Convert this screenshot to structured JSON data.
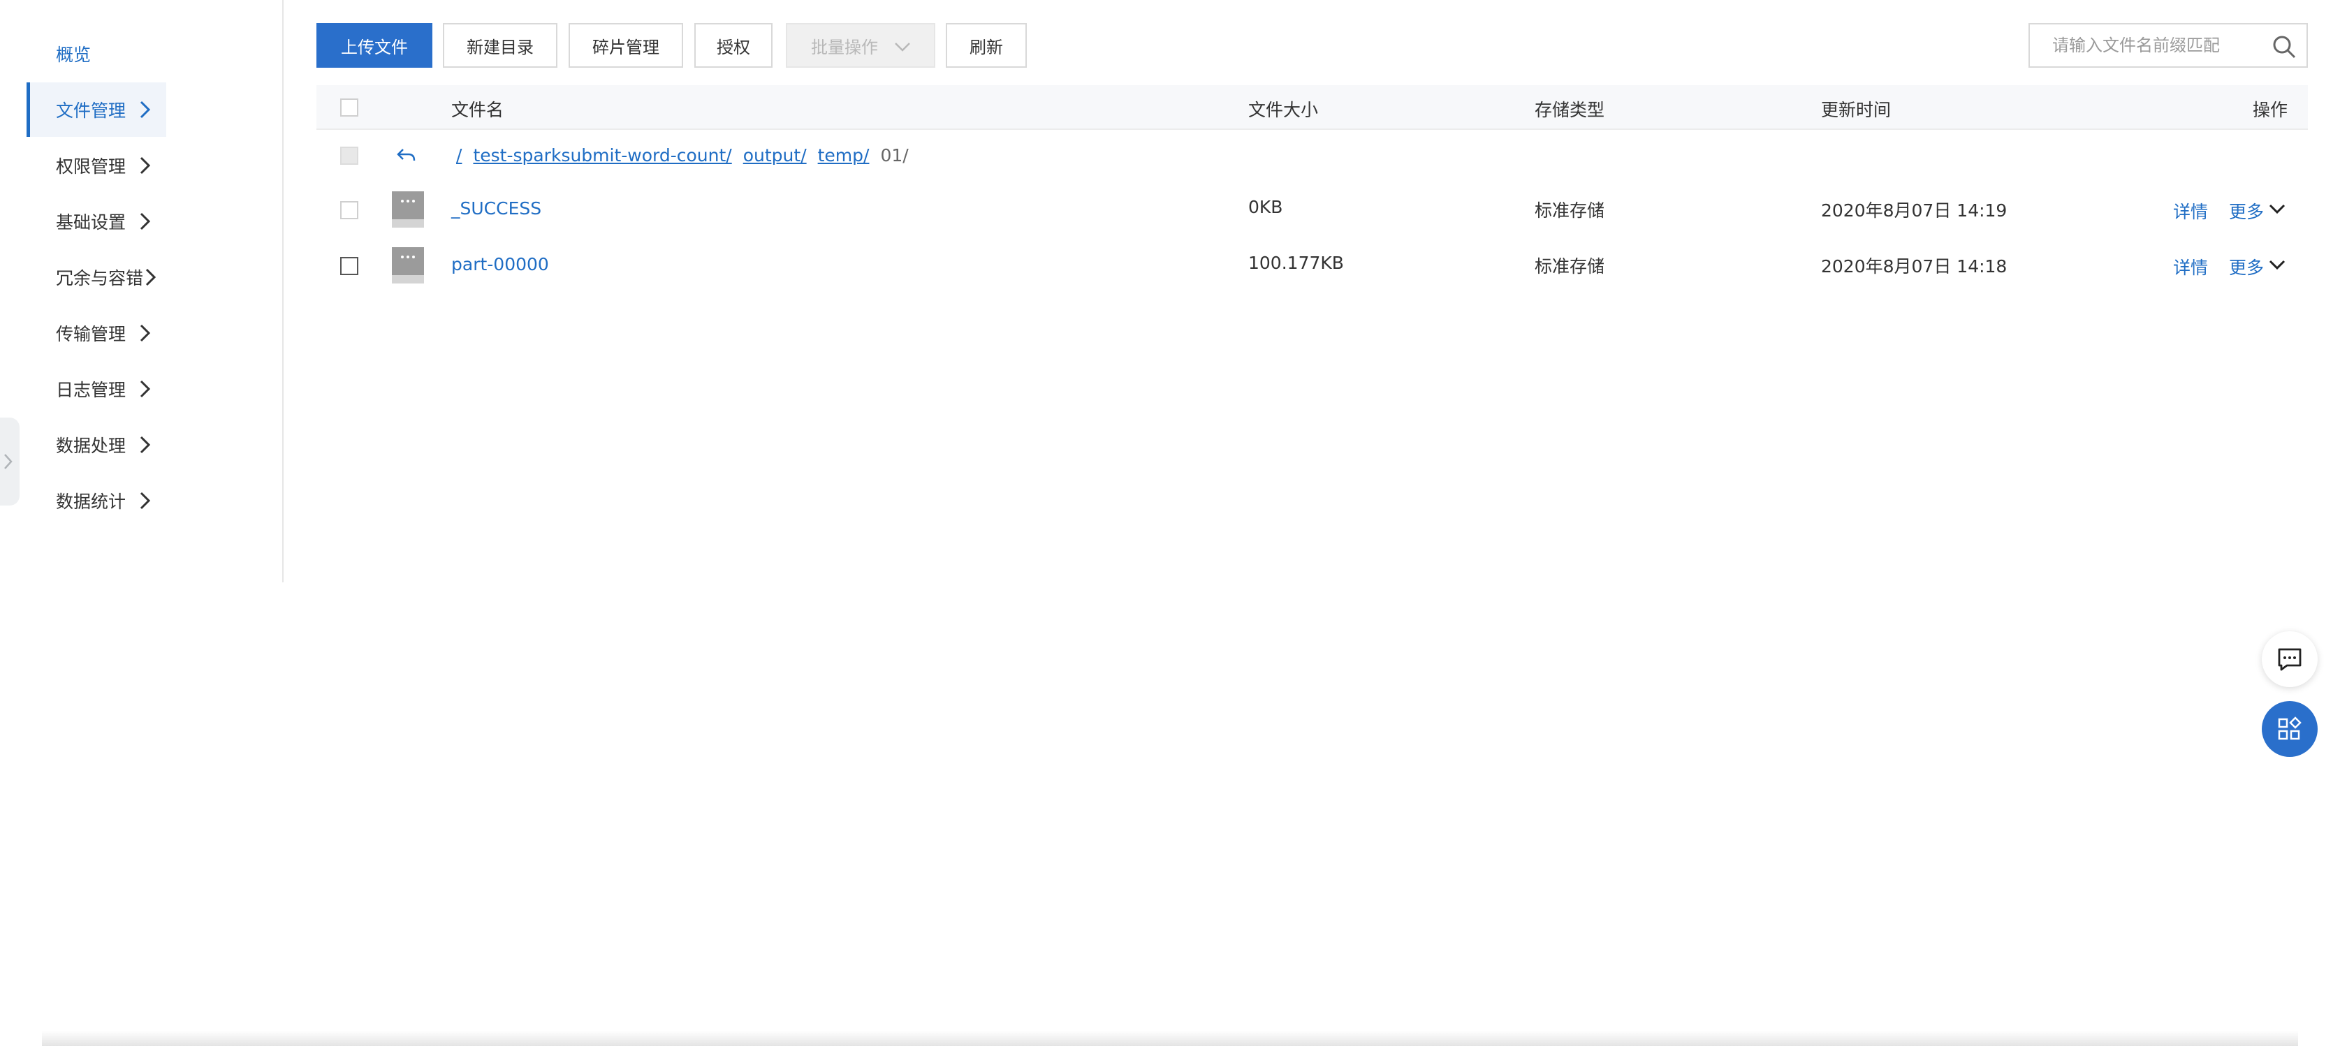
{
  "sidebar": {
    "overview": "概览",
    "items": [
      {
        "label": "文件管理",
        "active": true
      },
      {
        "label": "权限管理"
      },
      {
        "label": "基础设置"
      },
      {
        "label": "冗余与容错"
      },
      {
        "label": "传输管理"
      },
      {
        "label": "日志管理"
      },
      {
        "label": "数据处理"
      },
      {
        "label": "数据统计"
      }
    ]
  },
  "toolbar": {
    "upload": "上传文件",
    "new_dir": "新建目录",
    "fragments": "碎片管理",
    "authorize": "授权",
    "batch": "批量操作",
    "refresh": "刷新"
  },
  "search": {
    "placeholder": "请输入文件名前缀匹配",
    "value": ""
  },
  "table": {
    "headers": {
      "name": "文件名",
      "size": "文件大小",
      "storage": "存储类型",
      "updated": "更新时间",
      "actions": "操作"
    },
    "breadcrumb": [
      "/",
      "test-sparksubmit-word-count/",
      "output/",
      "temp/",
      "01/"
    ],
    "rows": [
      {
        "name": "_SUCCESS",
        "size": "0KB",
        "storage": "标准存储",
        "updated": "2020年8月07日 14:19",
        "detail": "详情",
        "more": "更多"
      },
      {
        "name": "part-00000",
        "size": "100.177KB",
        "storage": "标准存储",
        "updated": "2020年8月07日 14:18",
        "detail": "详情",
        "more": "更多"
      }
    ]
  },
  "colors": {
    "accent": "#1f6dc4",
    "primary_button": "#2a6fcb"
  },
  "icons": [
    "chevron-right-icon",
    "back-arrow-icon",
    "file-icon",
    "chevron-down-icon",
    "search-icon",
    "chat-icon",
    "apps-icon"
  ]
}
